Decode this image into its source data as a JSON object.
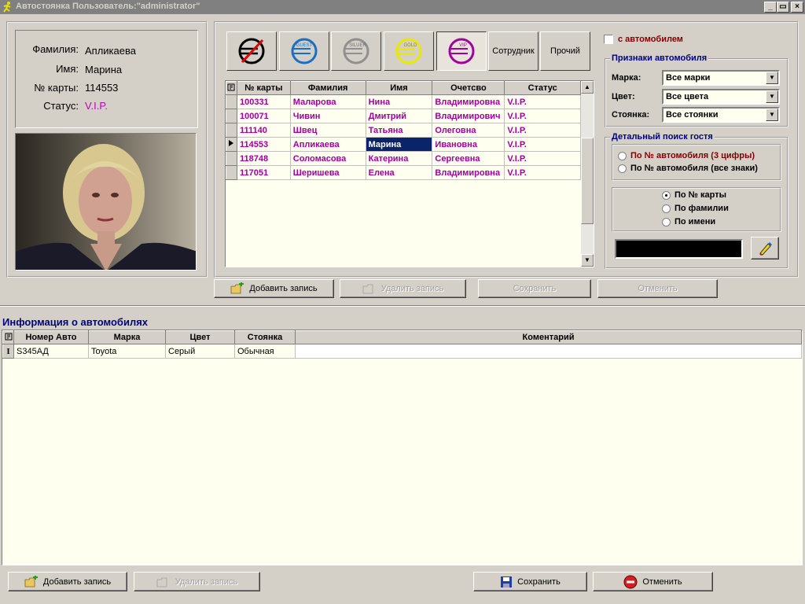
{
  "window": {
    "title": "Автостоянка Пользователь:\"administrator\"",
    "min": "_",
    "max": "▭",
    "close": "×"
  },
  "person": {
    "labels": {
      "surname": "Фамилия:",
      "name": "Имя:",
      "card": "№ карты:",
      "status": "Статус:"
    },
    "values": {
      "surname": "Апликаева",
      "name": "Марина",
      "card": "114553",
      "status": "V.I.P."
    }
  },
  "status_buttons": [
    {
      "id": "none",
      "caption": ""
    },
    {
      "id": "guest",
      "caption": "GUEST",
      "color": "#1a6fc4"
    },
    {
      "id": "silver",
      "caption": "SILUER",
      "color": "#909090"
    },
    {
      "id": "gold",
      "caption": "GOLD",
      "color": "#e0e000"
    },
    {
      "id": "vip",
      "caption": "VIP",
      "color": "#a000a0"
    },
    {
      "id": "employee",
      "caption": "Сотрудник"
    },
    {
      "id": "other",
      "caption": "Прочий"
    }
  ],
  "guests_table": {
    "columns": [
      "№ карты",
      "Фамилия",
      "Имя",
      "Очетсво",
      "Статус"
    ],
    "rows": [
      [
        "100331",
        "Маларова",
        "Нина",
        "Владимировна",
        "V.I.P."
      ],
      [
        "100071",
        "Чивин",
        "Дмитрий",
        "Владимирович",
        "V.I.P."
      ],
      [
        "111140",
        "Швец",
        "Татьяна",
        "Олеговна",
        "V.I.P."
      ],
      [
        "114553",
        "Апликаева",
        "Марина",
        "Ивановна",
        "V.I.P."
      ],
      [
        "118748",
        "Соломасова",
        "Катерина",
        "Сергеевна",
        "V.I.P."
      ],
      [
        "117051",
        "Шеришева",
        "Елена",
        "Владимировна",
        "V.I.P."
      ]
    ],
    "selected_row": 3
  },
  "with_car": {
    "label": "с автомобилем"
  },
  "car_signs": {
    "title": "Признаки автомобиля",
    "brand_label": "Марка:",
    "brand_value": "Все марки",
    "color_label": "Цвет:",
    "color_value": "Все цвета",
    "parking_label": "Стоянка:",
    "parking_value": "Все стоянки"
  },
  "detail_search": {
    "title": "Детальный поиск гостя",
    "options_car": [
      "По № автомобиля (3 цифры)",
      "По № автомобиля (все знаки)"
    ],
    "options_guest": [
      "По № карты",
      "По фамилии",
      "По имени"
    ],
    "search_value": ""
  },
  "top_actions": {
    "add": "Добавить запись",
    "delete": "Удалить запись",
    "save": "Сохранить",
    "cancel": "Отменить"
  },
  "cars": {
    "title": "Информация о автомобилях",
    "columns": [
      "Номер Авто",
      "Марка",
      "Цвет",
      "Стоянка",
      "Коментарий"
    ],
    "rows": [
      [
        "S345АД",
        "Toyota",
        "Серый",
        "Обычная",
        ""
      ]
    ]
  },
  "bottom_actions": {
    "add": "Добавить запись",
    "delete": "Удалить запись",
    "save": "Сохранить",
    "cancel": "Отменить"
  }
}
